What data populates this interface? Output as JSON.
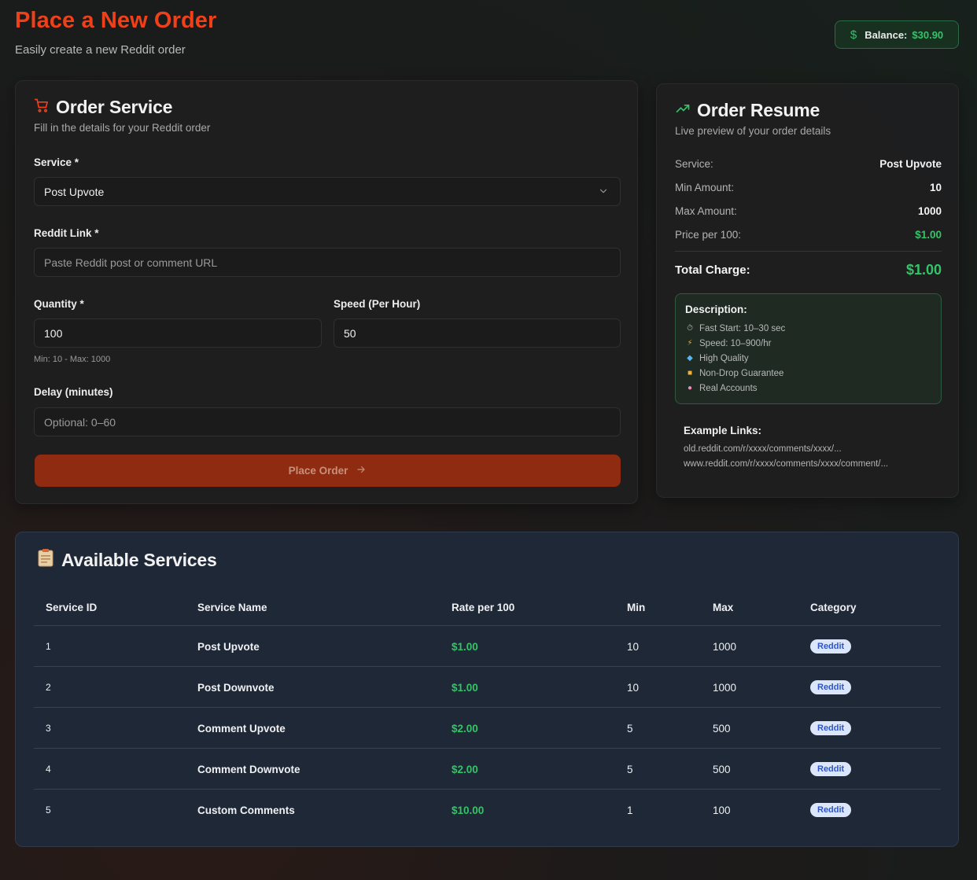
{
  "header": {
    "title": "Place a New Order",
    "subtitle": "Easily create a new Reddit order",
    "balance_label": "Balance:",
    "balance_value": "$30.90"
  },
  "order_form": {
    "title": "Order Service",
    "subtitle": "Fill in the details for your Reddit order",
    "service_label": "Service *",
    "service_value": "Post Upvote",
    "link_label": "Reddit Link *",
    "link_placeholder": "Paste Reddit post or comment URL",
    "quantity_label": "Quantity *",
    "quantity_value": "100",
    "quantity_hint": "Min: 10 - Max: 1000",
    "speed_label": "Speed (Per Hour)",
    "speed_value": "50",
    "delay_label": "Delay (minutes)",
    "delay_placeholder": "Optional: 0–60",
    "submit_label": "Place Order"
  },
  "resume": {
    "title": "Order Resume",
    "subtitle": "Live preview of your order details",
    "rows": [
      {
        "label": "Service:",
        "value": "Post Upvote"
      },
      {
        "label": "Min Amount:",
        "value": "10"
      },
      {
        "label": "Max Amount:",
        "value": "1000"
      },
      {
        "label": "Price per 100:",
        "value": "$1.00"
      }
    ],
    "total_label": "Total Charge:",
    "total_value": "$1.00",
    "description_title": "Description:",
    "description_items": [
      {
        "icon": "stopwatch-icon",
        "text": "Fast Start: 10–30 sec"
      },
      {
        "icon": "lightning-icon",
        "text": "Speed: 10–900/hr"
      },
      {
        "icon": "gem-icon",
        "text": "High Quality"
      },
      {
        "icon": "lock-icon",
        "text": "Non-Drop Guarantee"
      },
      {
        "icon": "brain-icon",
        "text": "Real Accounts"
      }
    ],
    "examples_title": "Example Links:",
    "example_links": [
      "old.reddit.com/r/xxxx/comments/xxxx/...",
      "www.reddit.com/r/xxxx/comments/xxxx/comment/..."
    ]
  },
  "services": {
    "title": "Available Services",
    "columns": [
      "Service ID",
      "Service Name",
      "Rate per 100",
      "Min",
      "Max",
      "Category"
    ],
    "rows": [
      {
        "id": "1",
        "name": "Post Upvote",
        "rate": "$1.00",
        "min": "10",
        "max": "1000",
        "category": "Reddit"
      },
      {
        "id": "2",
        "name": "Post Downvote",
        "rate": "$1.00",
        "min": "10",
        "max": "1000",
        "category": "Reddit"
      },
      {
        "id": "3",
        "name": "Comment Upvote",
        "rate": "$2.00",
        "min": "5",
        "max": "500",
        "category": "Reddit"
      },
      {
        "id": "4",
        "name": "Comment Downvote",
        "rate": "$2.00",
        "min": "5",
        "max": "500",
        "category": "Reddit"
      },
      {
        "id": "5",
        "name": "Custom Comments",
        "rate": "$10.00",
        "min": "1",
        "max": "100",
        "category": "Reddit"
      }
    ]
  },
  "colors": {
    "accent": "#f0401a",
    "success": "#34c467",
    "button": "#8f2b11",
    "badge_bg": "#dbe6fb",
    "badge_text": "#2f55c4"
  }
}
